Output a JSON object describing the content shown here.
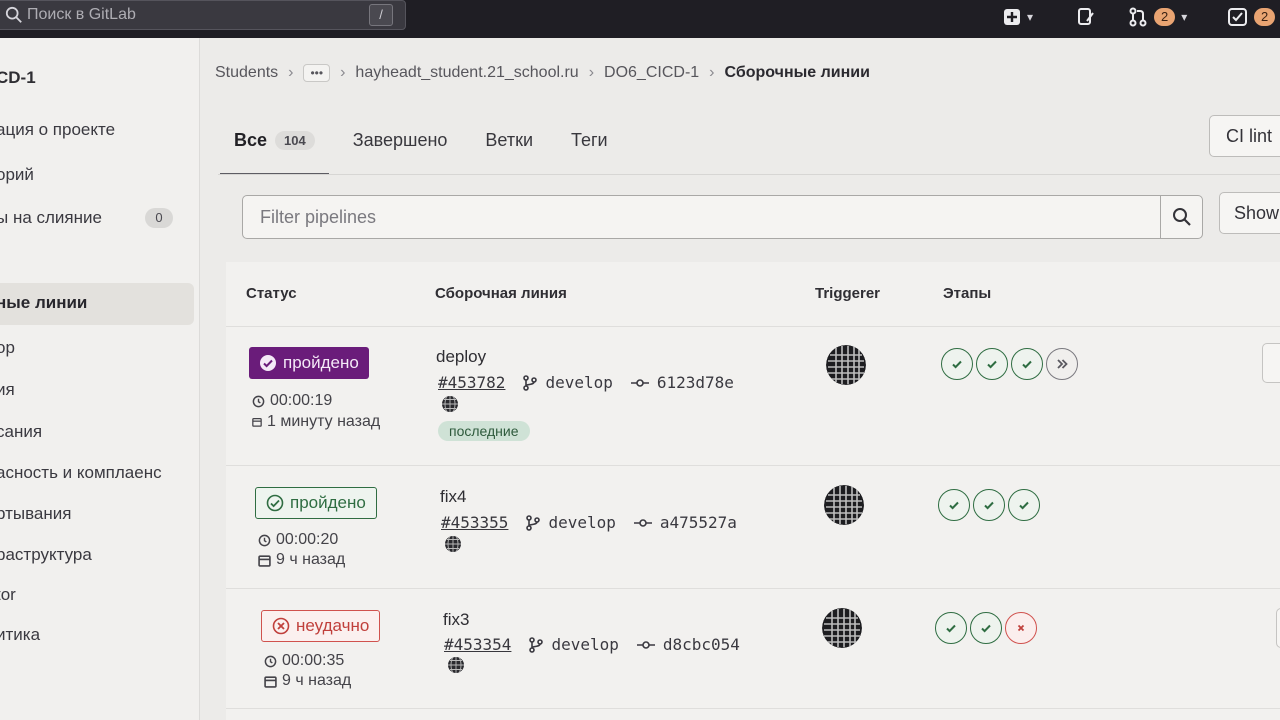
{
  "topbar": {
    "search_placeholder": "Поиск в GitLab",
    "shortcut_key": "/",
    "merge_requests_count": "2",
    "todos_count": "2"
  },
  "sidebar": {
    "project_title": "CD-1",
    "items": [
      {
        "label": "ация о проекте"
      },
      {
        "label": "орий"
      },
      {
        "label": "ы на слияние",
        "count": "0"
      },
      {
        "label": "ные линии",
        "active": true
      },
      {
        "label": "ор"
      },
      {
        "label": "ия"
      },
      {
        "label": "сания"
      },
      {
        "label": "асность и комплаенс"
      },
      {
        "label": "ртывания"
      },
      {
        "label": "раструктура"
      },
      {
        "label": "tor"
      },
      {
        "label": "итика"
      }
    ]
  },
  "breadcrumb": {
    "group": "Students",
    "more": "•••",
    "user": "hayheadt_student.21_school.ru",
    "project": "DO6_CICD-1",
    "current": "Сборочные линии"
  },
  "tabs": [
    {
      "label": "Все",
      "count": "104",
      "active": true
    },
    {
      "label": "Завершено"
    },
    {
      "label": "Ветки"
    },
    {
      "label": "Теги"
    }
  ],
  "buttons": {
    "ci_lint": "CI lint",
    "show": "Show"
  },
  "filter": {
    "placeholder": "Filter pipelines"
  },
  "table": {
    "headers": {
      "status": "Статус",
      "pipeline": "Сборочная линия",
      "triggerer": "Triggerer",
      "stages": "Этапы"
    },
    "rows": [
      {
        "status": "пройдено",
        "status_kind": "passed-filled",
        "duration": "00:00:19",
        "finished": "1 минуту назад",
        "name": "deploy",
        "id": "#453782",
        "branch": "develop",
        "commit": "6123d78e",
        "tag": "последние",
        "stages": [
          "success",
          "success",
          "success",
          "skipped"
        ]
      },
      {
        "status": "пройдено",
        "status_kind": "passed",
        "duration": "00:00:20",
        "finished": "9 ч назад",
        "name": "fix4",
        "id": "#453355",
        "branch": "develop",
        "commit": "a475527a",
        "stages": [
          "success",
          "success",
          "success"
        ]
      },
      {
        "status": "неудачно",
        "status_kind": "failed",
        "duration": "00:00:35",
        "finished": "9 ч назад",
        "name": "fix3",
        "id": "#453354",
        "branch": "develop",
        "commit": "d8cbc054",
        "stages": [
          "success",
          "success",
          "failed"
        ]
      }
    ]
  },
  "colors": {
    "passed_filled": "#6a1c7a",
    "passed": "#2f6d42",
    "failed": "#d0524e",
    "topbar": "#1f1e24"
  }
}
